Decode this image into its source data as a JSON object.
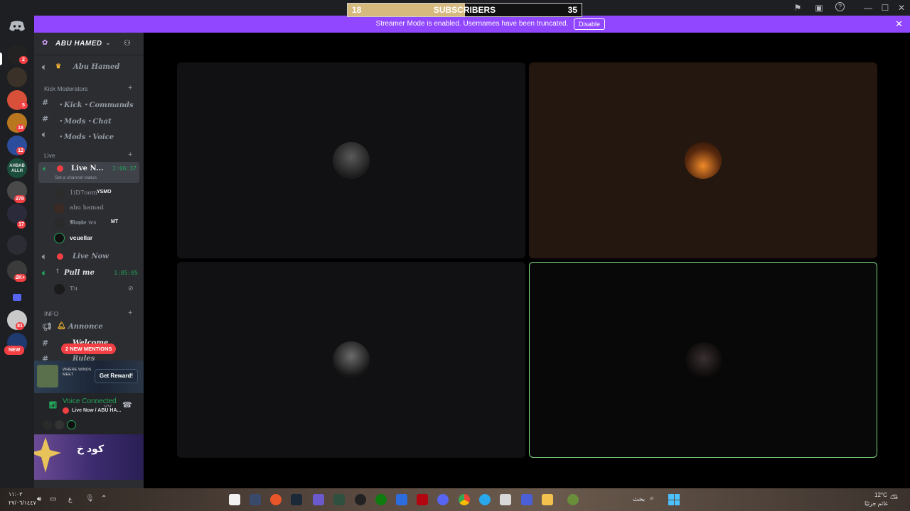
{
  "window": {
    "subscriber_overlay": {
      "left_count": "18",
      "title": "SUBSCRIBERS",
      "right_count": "35",
      "progress": 0.5
    }
  },
  "banner": {
    "text": "Streamer Mode is enabled. Usernames have been truncated.",
    "button": "Disable"
  },
  "servers": [
    {
      "badge": "2"
    },
    {
      "badge": ""
    },
    {
      "badge": "5"
    },
    {
      "badge": "18"
    },
    {
      "badge": "12"
    },
    {
      "label": "AHBAB ALLH",
      "badge": ""
    },
    {
      "badge": "278"
    },
    {
      "badge": "17"
    },
    {
      "badge": ""
    },
    {
      "badge": "2K+"
    },
    {
      "badge": ""
    },
    {
      "badge": "81"
    },
    {
      "badge": ""
    }
  ],
  "rail_new_badge": "NEW",
  "guild": {
    "name": "ABU HAMED"
  },
  "channels": {
    "top": {
      "name": "Abu Hamed"
    },
    "cat_kick": "Kick Moderators",
    "kick_commands": "・Kick・Commands",
    "mods_chat": "・Mods・Chat",
    "mods_voice": "・Mods・Voice",
    "cat_live": "Live",
    "live_now_active": "Live N...",
    "live_now_time": "2:06:37",
    "channel_status": "Set a channel status",
    "users": [
      {
        "name": "1iD7oom",
        "tag": "YSMO"
      },
      {
        "name": "abu hamad",
        "tag": ""
      },
      {
        "name": "𝕸𝖆𝖞𝖇𝖊 ws",
        "tag": "MT"
      },
      {
        "name": "vcuellar",
        "tag": ""
      }
    ],
    "live_now": "Live Now",
    "pull_me": "Pull me",
    "pull_me_time": "1:05:05",
    "pull_user": "Tu",
    "cat_info": "INFO",
    "annonce": "Annonce",
    "welcome": "Welcome",
    "rules": "Rules",
    "mentions_badge": "2 NEW MENTIONS"
  },
  "reward": {
    "title": "WHERE WINDS MEET",
    "button": "Get Reward!"
  },
  "voice": {
    "status": "Voice Connected",
    "channel": "Live Now / ABU HA..."
  },
  "promo": {
    "text": "كود خ"
  },
  "taskbar": {
    "time": "١١:٠٣",
    "date": "٢٧/٠٦/١٤٤٧",
    "lang": "ع",
    "search": "بحث",
    "weather_temp": "12°C",
    "weather_desc": "غائم جزئيًا"
  },
  "colors": {
    "banner": "#9147ff",
    "speaking_border": "#7ed87e",
    "online": "#23a55a",
    "mention": "#f23f43"
  }
}
